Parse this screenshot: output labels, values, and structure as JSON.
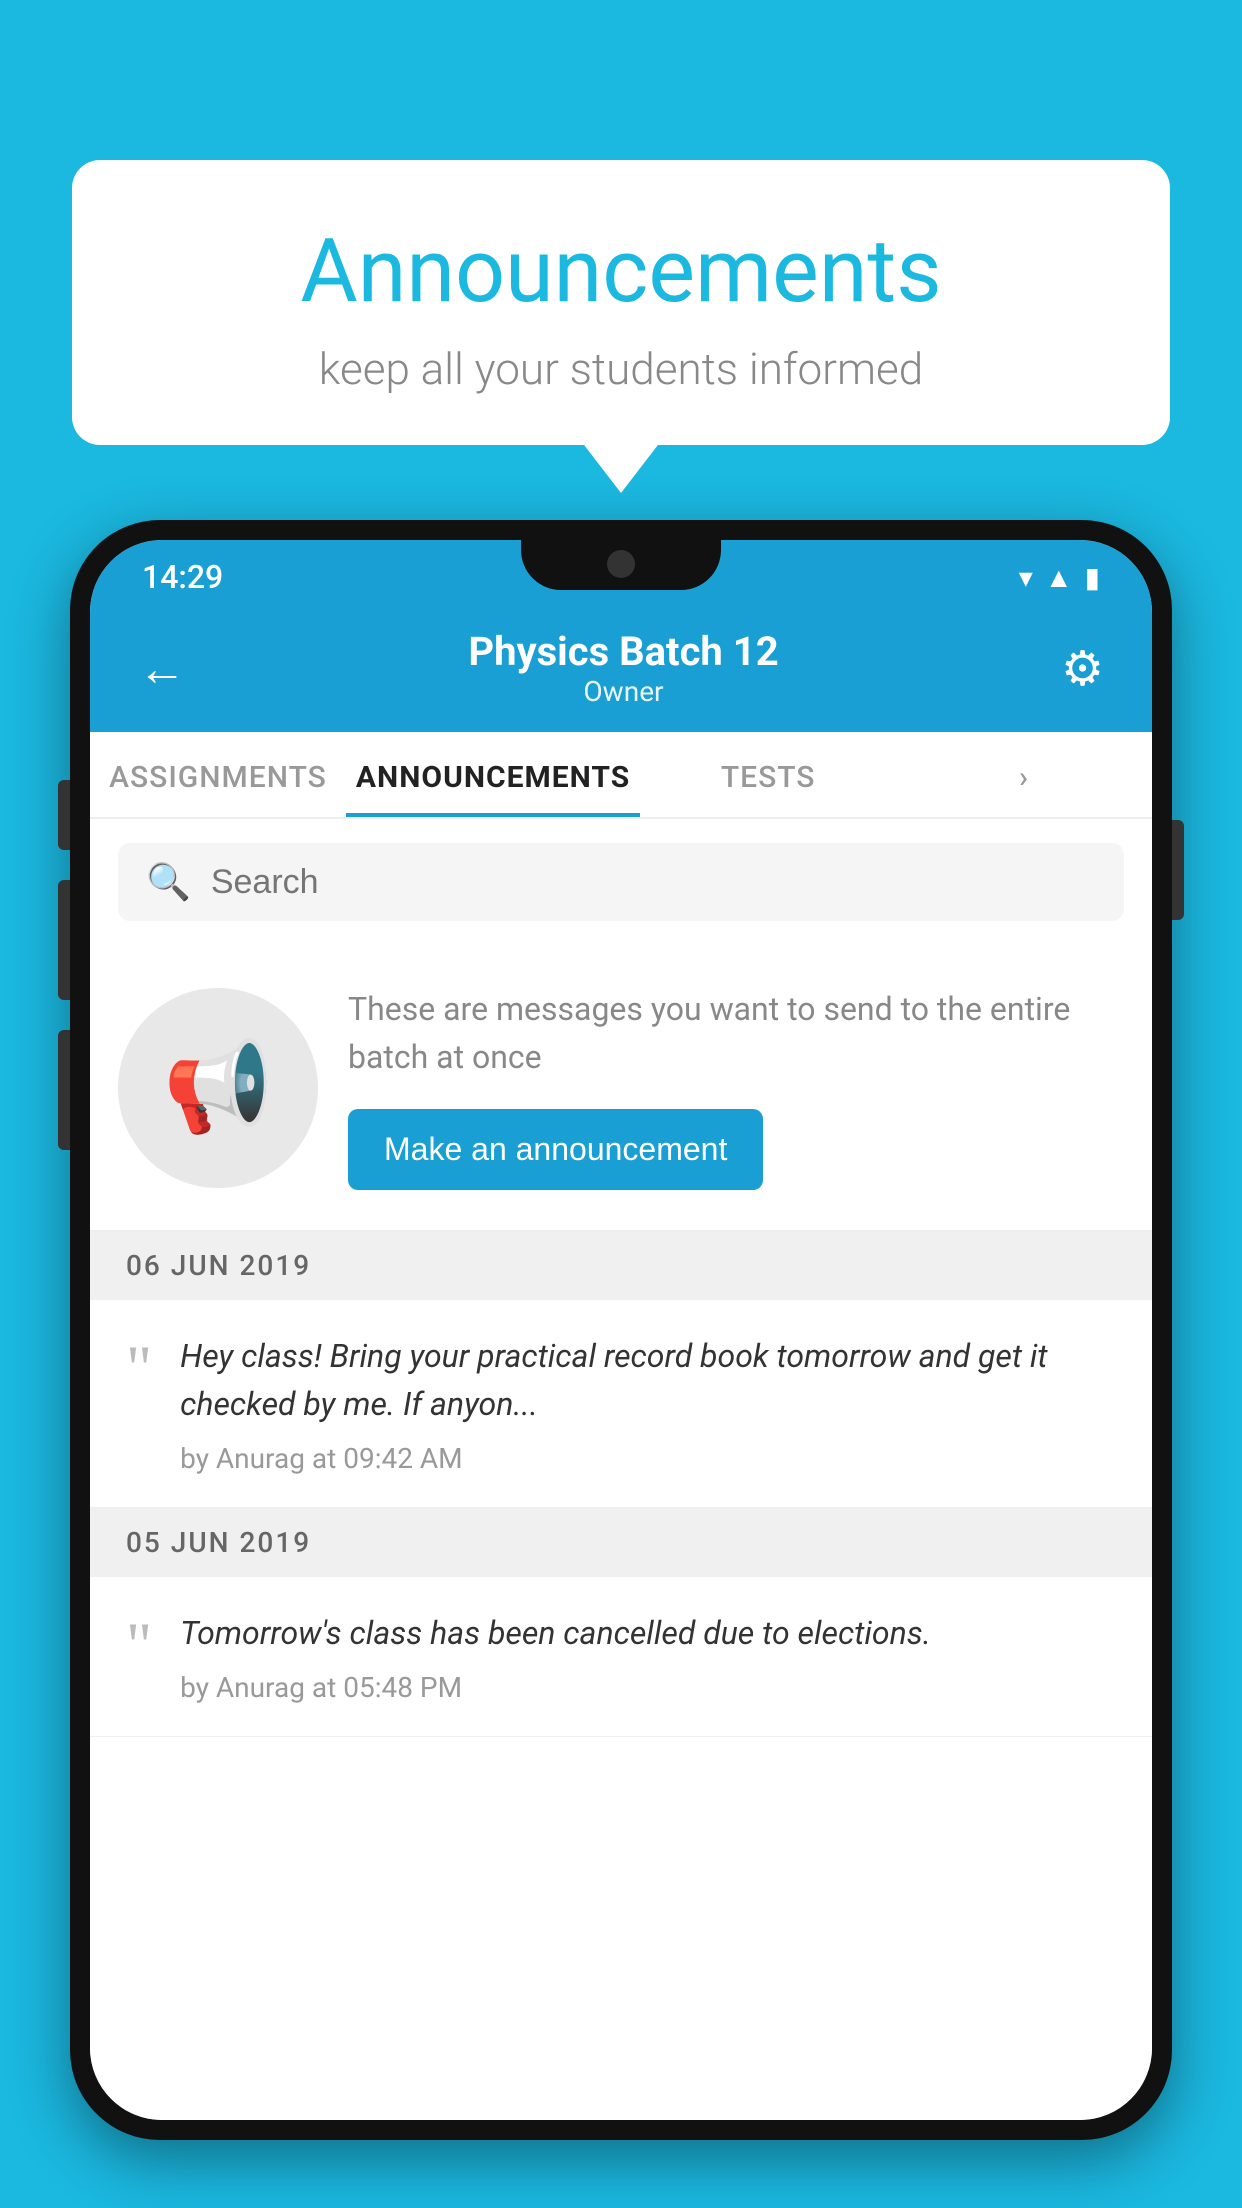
{
  "background_color": "#1BB8E0",
  "bubble": {
    "title": "Announcements",
    "subtitle": "keep all your students informed"
  },
  "status_bar": {
    "time": "14:29",
    "wifi": "▾",
    "signal": "▲",
    "battery": "▮"
  },
  "header": {
    "back_label": "←",
    "title": "Physics Batch 12",
    "subtitle": "Owner",
    "settings_label": "⚙"
  },
  "tabs": [
    {
      "label": "ASSIGNMENTS",
      "active": false
    },
    {
      "label": "ANNOUNCEMENTS",
      "active": true
    },
    {
      "label": "TESTS",
      "active": false
    },
    {
      "label": "›",
      "active": false
    }
  ],
  "search": {
    "placeholder": "Search"
  },
  "empty_state": {
    "message": "These are messages you want to send to the entire batch at once",
    "button_label": "Make an announcement"
  },
  "announcements": [
    {
      "date": "06  JUN  2019",
      "text": "Hey class! Bring your practical record book tomorrow and get it checked by me. If anyon...",
      "meta": "by Anurag at 09:42 AM"
    },
    {
      "date": "05  JUN  2019",
      "text": "Tomorrow's class has been cancelled due to elections.",
      "meta": "by Anurag at 05:48 PM"
    }
  ]
}
